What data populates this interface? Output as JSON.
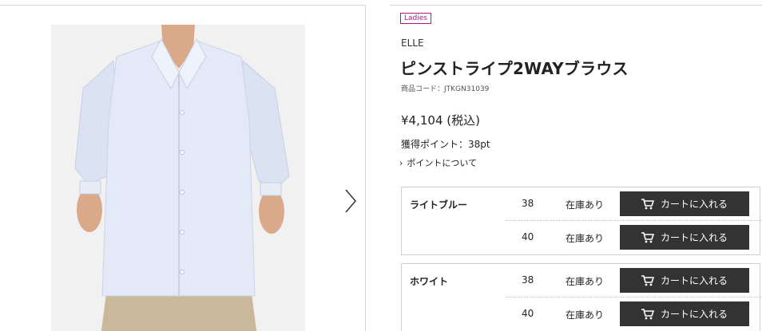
{
  "gallery": {
    "image_alt": "product-photo-blouse",
    "next_icon": "chevron-right-icon"
  },
  "product": {
    "badge": "Ladies",
    "brand": "ELLE",
    "title": "ピンストライプ2WAYブラウス",
    "code": "商品コード：JTKGN31039",
    "price": "¥4,104 (税込)",
    "points": "獲得ポイント：38pt",
    "points_link": "ポイントについて"
  },
  "variants": [
    {
      "name": "ライトブルー",
      "sizes": [
        {
          "size": "38",
          "stock": "在庫あり",
          "button": "カートに入れる"
        },
        {
          "size": "40",
          "stock": "在庫あり",
          "button": "カートに入れる"
        }
      ]
    },
    {
      "name": "ホワイト",
      "sizes": [
        {
          "size": "38",
          "stock": "在庫あり",
          "button": "カートに入れる"
        },
        {
          "size": "40",
          "stock": "在庫あり",
          "button": "カートに入れる"
        }
      ]
    }
  ],
  "colors": {
    "badge": "#b0168a",
    "button": "#333333",
    "border": "#cfcfcf"
  }
}
